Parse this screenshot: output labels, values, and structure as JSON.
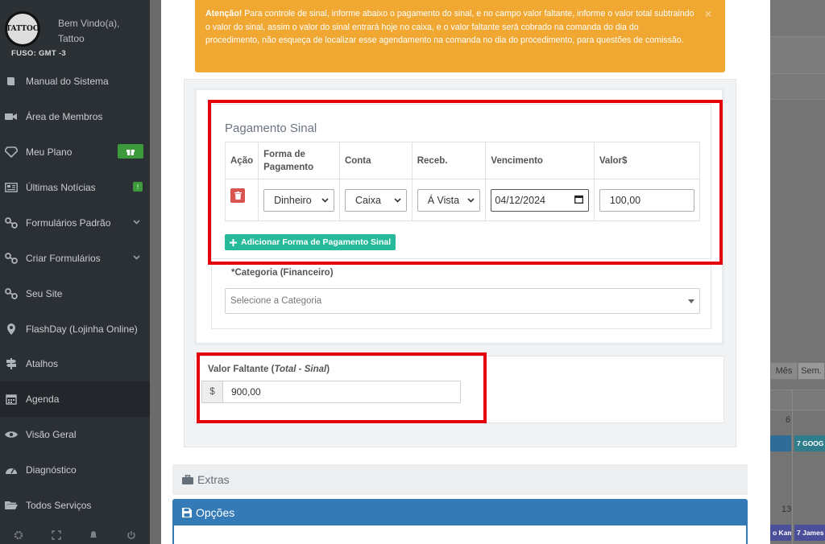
{
  "sidebar": {
    "logo_text": "TATTOO",
    "welcome_line1": "Bem Vindo(a),",
    "welcome_line2": "Tattoo",
    "timezone": "FUSO: GMT -3",
    "items": [
      {
        "label": "Manual do Sistema"
      },
      {
        "label": "Área de Membros"
      },
      {
        "label": "Meu Plano"
      },
      {
        "label": "Últimas Notícias",
        "badge": "!"
      },
      {
        "label": "Formulários Padrão"
      },
      {
        "label": "Criar Formulários"
      },
      {
        "label": "Seu Site"
      },
      {
        "label": "FlashDay (Lojinha Online)"
      },
      {
        "label": "Atalhos"
      },
      {
        "label": "Agenda"
      },
      {
        "label": "Visão Geral"
      },
      {
        "label": "Diagnóstico"
      },
      {
        "label": "Todos Serviços"
      }
    ]
  },
  "background": {
    "tab_month": "Mês",
    "tab_week": "Sem.",
    "day_6": "6",
    "day_13": "13",
    "event_1": "7 GOOG",
    "event_2": "o Kam",
    "event_3": "7 James"
  },
  "alert": {
    "strong": "Atenção!",
    "text": " Para controle de sinal, informe abaixo o pagamento do sinal, e no campo valor faltante, informe o valor total subtraindo o valor do sinal, assim o valor do sinal entrará hoje no caixa, e o valor faltante será cobrado na comanda do dia do procedimento, não esqueça de localizar esse agendamento na comanda no dia do procedimento, para questões de comissão.",
    "close": "×"
  },
  "payment": {
    "title": "Pagamento Sinal",
    "headers": {
      "acao": "Ação",
      "forma": "Forma de Pagamento",
      "conta": "Conta",
      "receb": "Receb.",
      "vencimento": "Vencimento",
      "valor": "Valor$"
    },
    "row": {
      "forma": "Dinheiro",
      "conta": "Caixa",
      "receb": "Á Vista",
      "vencimento": "04/12/2024",
      "valor": "100,00"
    },
    "add_button": "Adicionar Forma de Pagamento Sinal"
  },
  "categoria": {
    "label": "*Categoria (Financeiro)",
    "placeholder": "Selecione a Categoria"
  },
  "valor_faltante": {
    "label_prefix": "Valor Faltante (",
    "label_italic": "Total - Sinal",
    "label_suffix": ")",
    "currency": "$",
    "value": "900,00"
  },
  "sections": {
    "extras": "Extras",
    "opcoes": "Opções"
  },
  "colors": {
    "alert": "#f0a833",
    "highlight": "#e5000a",
    "add_button": "#26b99a",
    "delete_button": "#d9534f",
    "opcoes_header": "#337ab7"
  }
}
